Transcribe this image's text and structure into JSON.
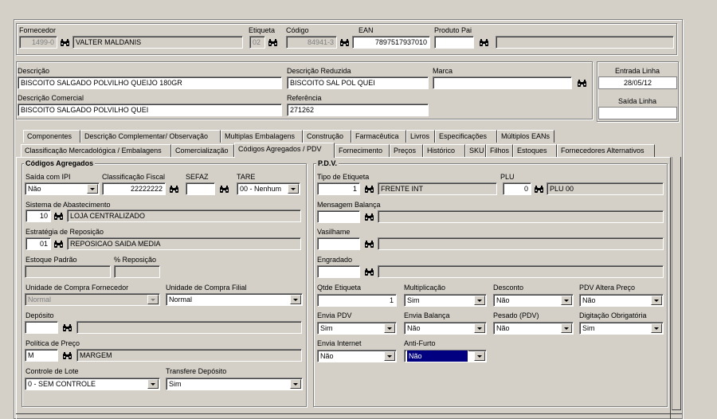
{
  "header": {
    "fornecedor_label": "Fornecedor",
    "fornecedor_code": "1499-0",
    "fornecedor_name": "VALTER MALDANIS",
    "etiqueta_label": "Etiqueta",
    "etiqueta_value": "02",
    "codigo_label": "Código",
    "codigo_value": "84941-3",
    "ean_label": "EAN",
    "ean_value": "7897517937010",
    "produto_pai_label": "Produto Pai",
    "produto_pai_value": ""
  },
  "descricao": {
    "descricao_label": "Descrição",
    "descricao_value": "BISCOITO SALGADO POLVILHO QUEIJO 180GR",
    "reduzida_label": "Descrição Reduzida",
    "reduzida_value": "BISCOITO SAL POL QUEI",
    "marca_label": "Marca",
    "marca_value": "",
    "comercial_label": "Descrição Comercial",
    "comercial_value": "BISCOITO SALGADO POLVILHO QUEI",
    "referencia_label": "Referência",
    "referencia_value": "271262",
    "entrada_label": "Entrada Linha",
    "entrada_value": "28/05/12",
    "saida_label": "Saída Linha",
    "saida_value": ""
  },
  "tabs_row1": [
    "Componentes",
    "Descrição Complementar/ Observação",
    "Multiplas Embalagens",
    "Construção",
    "Farmacêutica",
    "Livros",
    "Especificações",
    "Múltiplos EANs"
  ],
  "tabs_row2": [
    "Classificação Mercadológica / Embalagens",
    "Comercialização",
    "Códigos Agregados / PDV",
    "Fornecimento",
    "Preços",
    "Histórico",
    "SKU",
    "Filhos",
    "Estoques",
    "Fornecedores Alternativos"
  ],
  "codigos": {
    "title": "Códigos Agregados",
    "saida_ipi_label": "Saída com IPI",
    "saida_ipi_value": "Não",
    "class_fiscal_label": "Classificação Fiscal",
    "class_fiscal_value": "22222222",
    "sefaz_label": "SEFAZ",
    "sefaz_value": "",
    "tare_label": "TARE",
    "tare_value": "00 - Nenhum",
    "sistema_label": "Sistema de Abastecimento",
    "sistema_code": "10",
    "sistema_name": "LOJA CENTRALIZADO",
    "estrategia_label": "Estratégia de Reposição",
    "estrategia_code": "01",
    "estrategia_name": "REPOSICAO SAIDA MEDIA",
    "estoque_padrao_label": "Estoque Padrão",
    "estoque_padrao_value": "",
    "pct_reposicao_label": "% Reposição",
    "pct_reposicao_value": "",
    "un_compra_forn_label": "Unidade de Compra Fornecedor",
    "un_compra_forn_value": "Normal",
    "un_compra_filial_label": "Unidade de Compra Filial",
    "un_compra_filial_value": "Normal",
    "deposito_label": "Depósito",
    "deposito_value": "",
    "politica_label": "Política de Preço",
    "politica_code": "M",
    "politica_name": "MARGEM",
    "controle_lote_label": "Controle de Lote",
    "controle_lote_value": "0 - SEM CONTROLE",
    "transfere_label": "Transfere Depósito",
    "transfere_value": "Sim"
  },
  "pdv": {
    "title": "P.D.V.",
    "tipo_etiqueta_label": "Tipo de Etiqueta",
    "tipo_etiqueta_code": "1",
    "tipo_etiqueta_name": "FRENTE INT",
    "plu_label": "PLU",
    "plu_code": "0",
    "plu_name": "PLU 00",
    "mensagem_label": "Mensagem Balança",
    "vasilhame_label": "Vasilhame",
    "engradado_label": "Engradado",
    "qtde_etiqueta_label": "Qtde Etiqueta",
    "qtde_etiqueta_value": "1",
    "multiplicacao_label": "Multiplicação",
    "multiplicacao_value": "Sim",
    "desconto_label": "Desconto",
    "desconto_value": "Não",
    "pdv_altera_label": "PDV Altera Preço",
    "pdv_altera_value": "Não",
    "envia_pdv_label": "Envia PDV",
    "envia_pdv_value": "Sim",
    "envia_balanca_label": "Envia Balança",
    "envia_balanca_value": "Não",
    "pesado_label": "Pesado (PDV)",
    "pesado_value": "Não",
    "digitacao_label": "Digitação Obrigatória",
    "digitacao_value": "Sim",
    "envia_internet_label": "Envia Internet",
    "envia_internet_value": "Não",
    "anti_furto_label": "Anti-Furto",
    "anti_furto_value": "Não"
  }
}
